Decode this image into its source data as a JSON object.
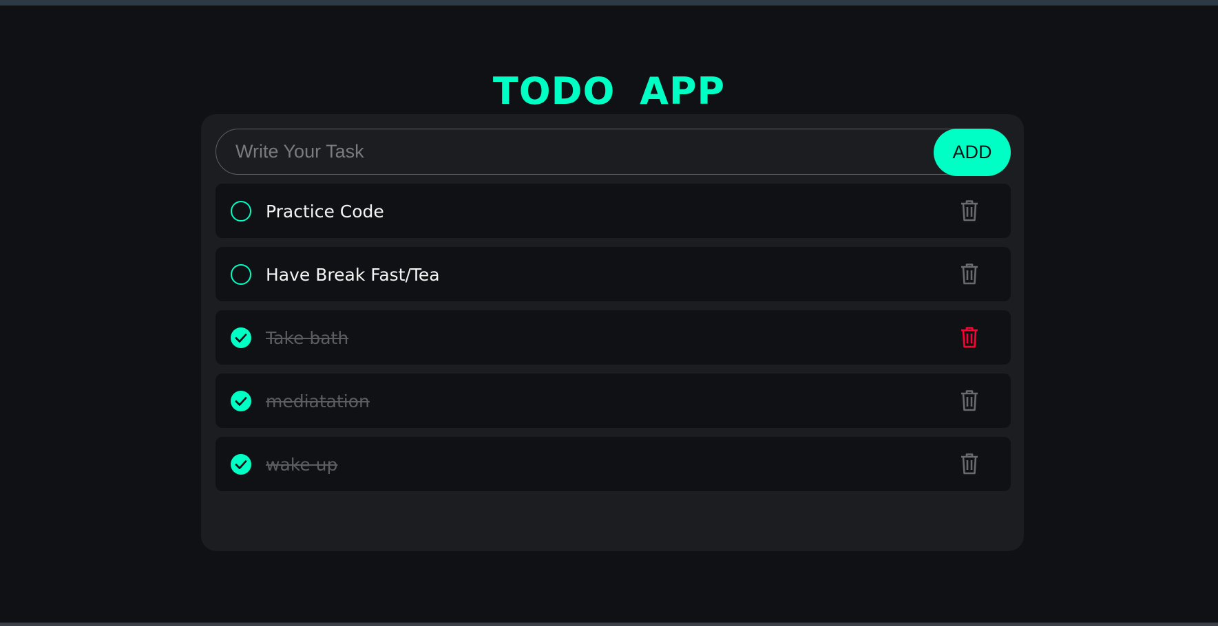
{
  "app": {
    "title": "TODO  APP"
  },
  "input": {
    "placeholder": "Write Your Task",
    "value": ""
  },
  "add_button": {
    "label": "ADD"
  },
  "todos": [
    {
      "text": "Practice Code",
      "completed": false,
      "delete_hovered": false
    },
    {
      "text": "Have Break Fast/Tea",
      "completed": false,
      "delete_hovered": false
    },
    {
      "text": "Take bath",
      "completed": true,
      "delete_hovered": true
    },
    {
      "text": "mediatation",
      "completed": true,
      "delete_hovered": false
    },
    {
      "text": "wake up",
      "completed": true,
      "delete_hovered": false
    }
  ],
  "icons": {
    "unchecked": "circle-outline-icon",
    "checked": "check-circle-icon",
    "delete": "trash-icon"
  },
  "colors": {
    "accent": "#00ffc4",
    "background": "#101114",
    "card": "#1c1d20",
    "muted_text": "#5c5d61",
    "delete_idle": "#6a6b6f",
    "delete_hover": "#ff0033"
  }
}
